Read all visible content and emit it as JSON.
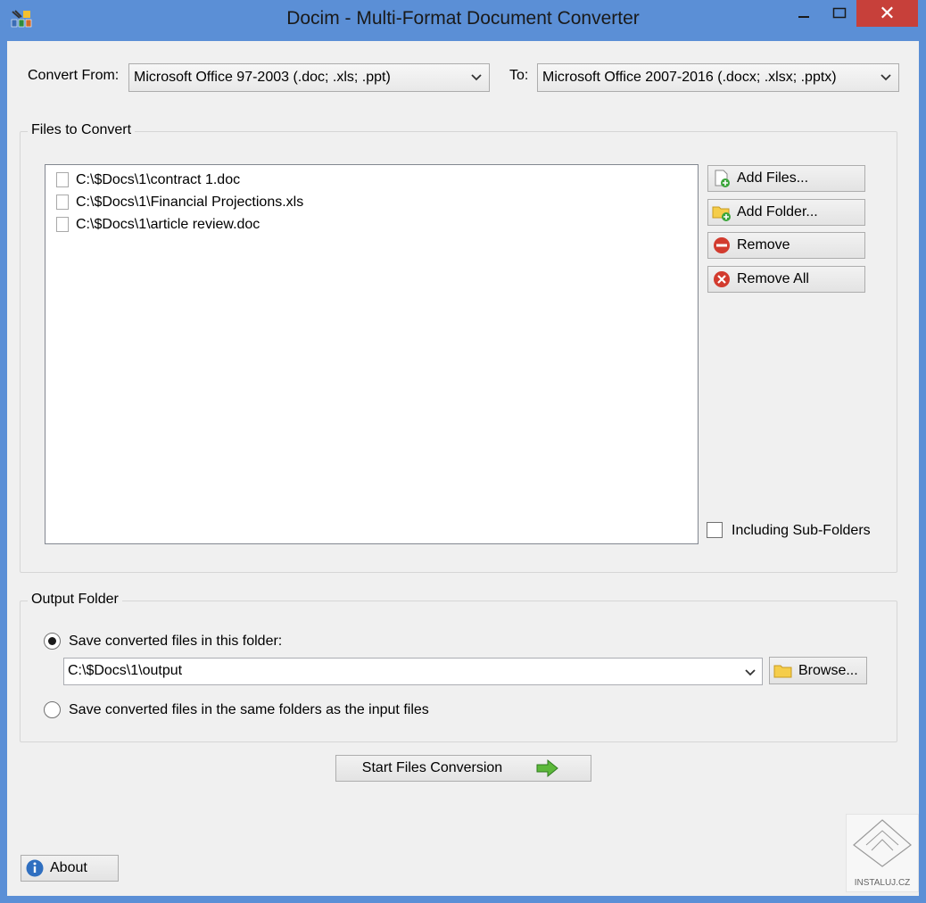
{
  "window": {
    "title": "Docim - Multi-Format Document Converter",
    "close_glyph": "✕"
  },
  "convert": {
    "from_label": "Convert From:",
    "from_value": "Microsoft Office 97-2003 (.doc; .xls; .ppt)",
    "to_label": "To:",
    "to_value": "Microsoft Office 2007-2016 (.docx; .xlsx; .pptx)"
  },
  "files_group": {
    "title": "Files to Convert",
    "files": [
      {
        "path": "C:\\$Docs\\1\\contract 1.doc"
      },
      {
        "path": "C:\\$Docs\\1\\Financial Projections.xls"
      },
      {
        "path": "C:\\$Docs\\1\\article review.doc"
      }
    ],
    "add_files_label": "Add Files...",
    "add_folder_label": "Add Folder...",
    "remove_label": "Remove",
    "remove_all_label": "Remove All",
    "subfolders_label": "Including Sub-Folders"
  },
  "output_group": {
    "title": "Output Folder",
    "option_this_folder": "Save converted files in this folder:",
    "folder_path": "C:\\$Docs\\1\\output",
    "browse_label": "Browse...",
    "option_same_folders": "Save converted files in the same folders as the input files"
  },
  "start_label": "Start Files Conversion",
  "about_label": "About",
  "watermark_text": "INSTALUJ.CZ",
  "colors": {
    "title_bar": "#5b8fd6",
    "close_button": "#c7403a",
    "client_bg": "#f0f0f0",
    "remove_red": "#d23b2e",
    "add_green": "#3aa53a",
    "arrow_green": "#5cb83a",
    "about_blue": "#2f6fc0"
  }
}
